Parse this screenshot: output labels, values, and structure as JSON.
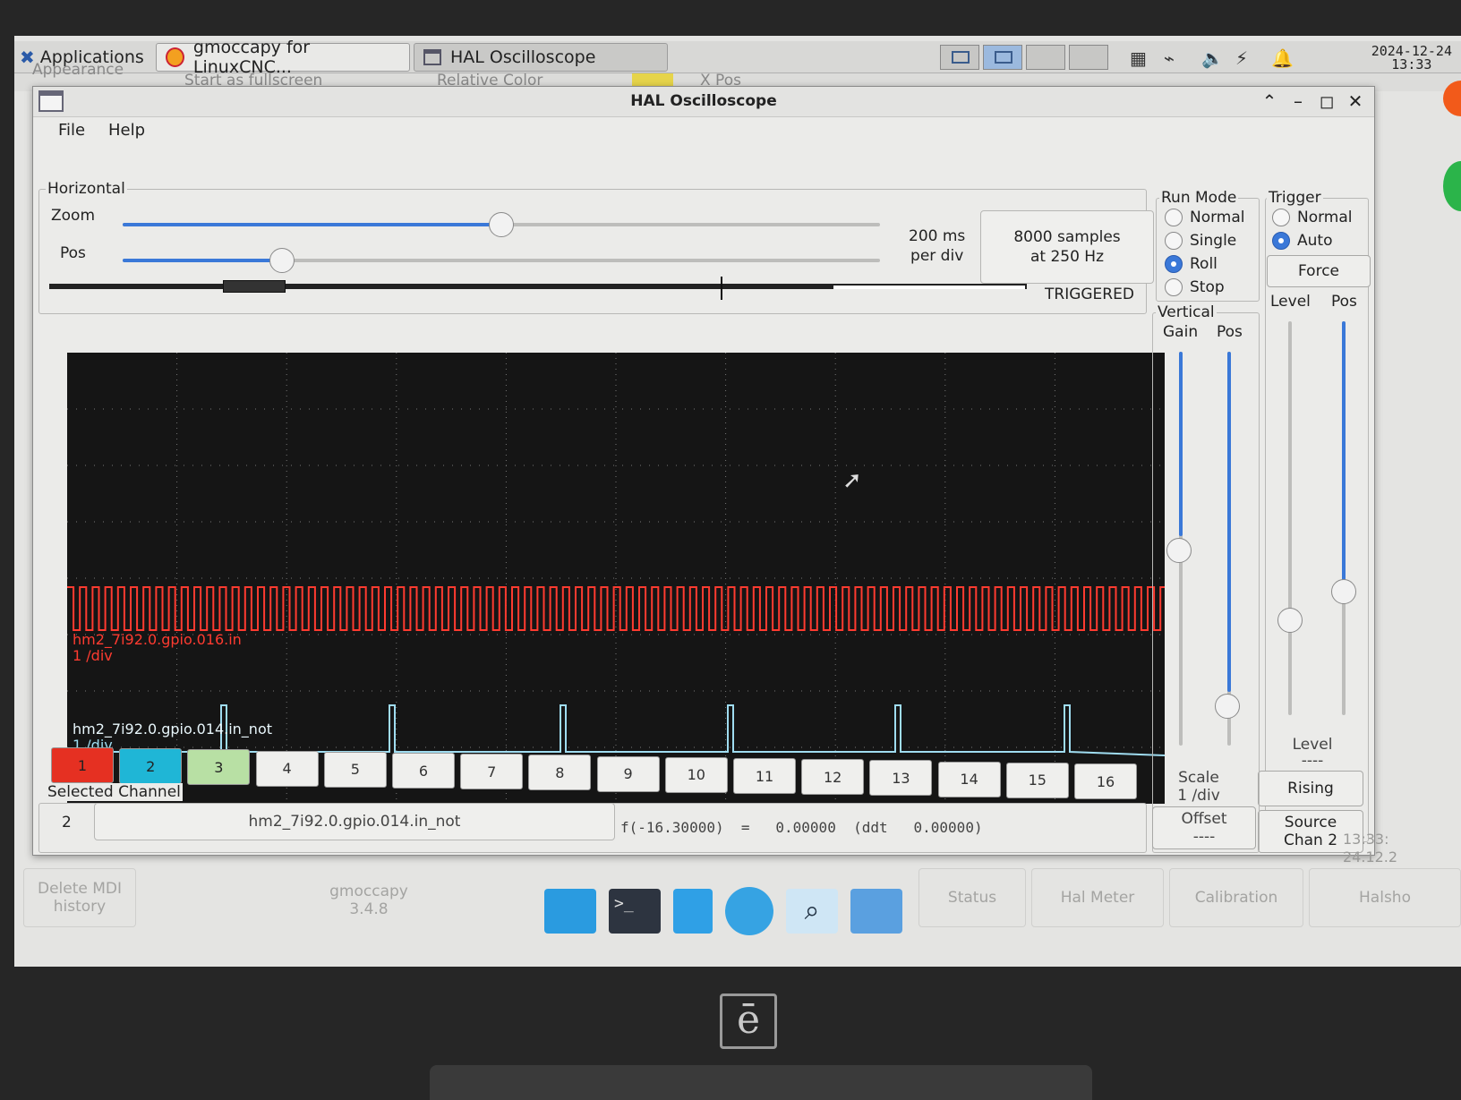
{
  "panel": {
    "applications_label": "Applications",
    "task_gmoccapy": "gmoccapy for LinuxCNC...",
    "task_halscope": "HAL Oscilloscope",
    "clock_date": "2024-12-24",
    "clock_time": "13:33"
  },
  "background": {
    "appearance": "Appearance",
    "fullscreen": "Start as fullscreen",
    "relative_color": "Relative Color",
    "x_pos": "X Pos",
    "side_time": "13:33:",
    "side_date": "24.12.2",
    "delete_mdi": "Delete MDI history",
    "gmoccapy_version": "gmoccapy 3.4.8",
    "status": "Status",
    "hal_meter": "Hal Meter",
    "calibration": "Calibration",
    "halshow": "Halsho"
  },
  "window": {
    "title": "HAL Oscilloscope",
    "menu": {
      "file": "File",
      "help": "Help"
    }
  },
  "horizontal": {
    "frame_label": "Horizontal",
    "zoom_label": "Zoom",
    "pos_label": "Pos",
    "zoom_value": 0.5,
    "pos_value": 0.21,
    "rate_line1": "200 ms",
    "rate_line2": "per div",
    "samples_line1": "8000 samples",
    "samples_line2": "at 250 Hz",
    "status": "TRIGGERED"
  },
  "run_mode": {
    "frame_label": "Run Mode",
    "options": [
      "Normal",
      "Single",
      "Roll",
      "Stop"
    ],
    "selected": "Roll"
  },
  "trigger": {
    "frame_label": "Trigger",
    "options": [
      "Normal",
      "Auto"
    ],
    "selected": "Auto",
    "force_label": "Force",
    "level_label": "Level",
    "pos_label": "Pos",
    "level_caption": "Level",
    "level_value": "----",
    "edge_label": "Rising",
    "source_label": "Source",
    "source_value": "Chan  2"
  },
  "vertical": {
    "frame_label": "Vertical",
    "gain_label": "Gain",
    "pos_label": "Pos",
    "scale_label": "Scale",
    "scale_value": "1 /div",
    "offset_label": "Offset",
    "offset_value": "----"
  },
  "traces": [
    {
      "name": "hm2_7i92.0.gpio.016.in",
      "scale": "1 /div",
      "color": "#ff3b30"
    },
    {
      "name": "hm2_7i92.0.gpio.014.in_not",
      "scale": "1 /div",
      "color": "#9fdcf0"
    }
  ],
  "channels": [
    "1",
    "2",
    "3",
    "4",
    "5",
    "6",
    "7",
    "8",
    "9",
    "10",
    "11",
    "12",
    "13",
    "14",
    "15",
    "16"
  ],
  "channel_colors": {
    "1": "#e53022",
    "2": "#1fb6d6",
    "3": "#b8e0a4"
  },
  "selected_channel": {
    "frame_label": "Selected Channel",
    "number": "2",
    "signal": "hm2_7i92.0.gpio.014.in_not",
    "readout": "f(-16.30000)  =   0.00000  (ddt   0.00000)"
  }
}
